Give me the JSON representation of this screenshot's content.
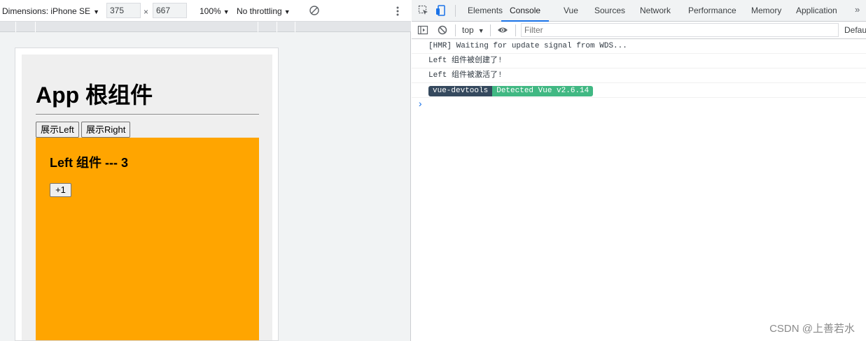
{
  "device_toolbar": {
    "dimensions_label": "Dimensions: iPhone SE",
    "width_value": "375",
    "height_value": "667",
    "times_sign": "×",
    "zoom_label": "100%",
    "throttle_label": "No throttling",
    "caret": "▼"
  },
  "app": {
    "title": "App 根组件",
    "show_left_label": "展示Left",
    "show_right_label": "展示Right",
    "left_component": {
      "title": "Left 组件 --- 3",
      "increment_label": "+1"
    },
    "colors": {
      "left_bg": "#ffa500",
      "root_bg": "#efefef"
    }
  },
  "devtools": {
    "tabs": [
      "Elements",
      "Console",
      "Vue",
      "Sources",
      "Network",
      "Performance",
      "Memory",
      "Application"
    ],
    "active_tab": "Console",
    "more_tabs": "»",
    "console_bar": {
      "context": "top",
      "filter_placeholder": "Filter",
      "levels_label": "Defau"
    },
    "logs": [
      "[HMR] Waiting for update signal from WDS...",
      "Left 组件被创建了!",
      "Left 组件被激活了!"
    ],
    "vue_badge": {
      "left": "vue-devtools",
      "right": "Detected Vue v2.6.14"
    },
    "prompt": "›",
    "colors": {
      "accent": "#1a73e8",
      "badge_dark": "#35495e",
      "badge_green": "#41b883"
    }
  },
  "watermark": "CSDN @上善若水"
}
